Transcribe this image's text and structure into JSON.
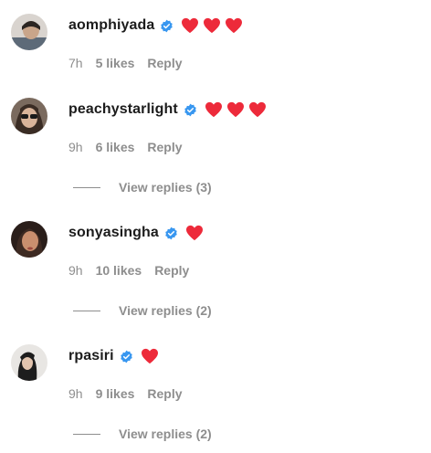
{
  "comments": [
    {
      "username": "aomphiyada",
      "hearts": 3,
      "time": "7h",
      "likes": "5 likes",
      "reply": "Reply",
      "view_replies": ""
    },
    {
      "username": "peachystarlight",
      "hearts": 3,
      "time": "9h",
      "likes": "6 likes",
      "reply": "Reply",
      "view_replies": "View replies (3)"
    },
    {
      "username": "sonyasingha",
      "hearts": 1,
      "time": "9h",
      "likes": "10 likes",
      "reply": "Reply",
      "view_replies": "View replies (2)"
    },
    {
      "username": "rpasiri",
      "hearts": 1,
      "time": "9h",
      "likes": "9 likes",
      "reply": "Reply",
      "view_replies": "View replies (2)"
    }
  ],
  "colors": {
    "heart": "#ed2a3a",
    "verified": "#3897f0",
    "muted": "#8e8e8e",
    "text": "#1c1c1c"
  },
  "icons": {
    "verified": "verified-badge-icon",
    "heart": "heart-icon"
  }
}
